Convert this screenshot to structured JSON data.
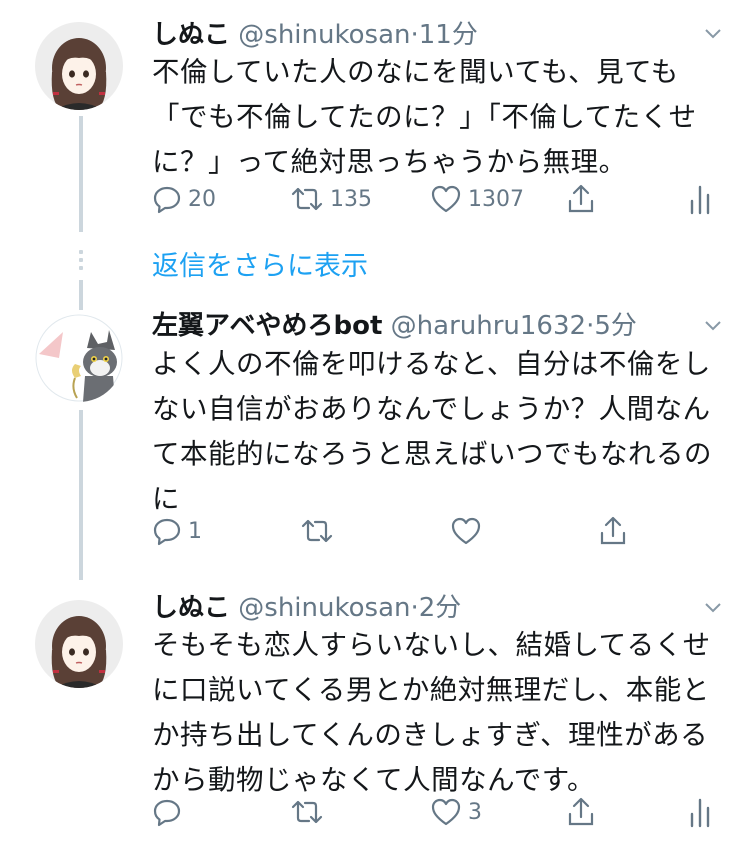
{
  "tweets": [
    {
      "name": "しぬこ",
      "handle": "@shinukosan",
      "time": "11分",
      "lines": [
        "不倫していた人のなにを聞いても、見ても",
        "「でも不倫してたのに？」「不倫してたくせ",
        "に？」って絶対思っちゃうから無理。"
      ],
      "reply_count": "20",
      "retweet_count": "135",
      "like_count": "1307"
    },
    {
      "name": "左翼アベやめろbot",
      "handle": "@haruhru1632",
      "time": "5分",
      "lines": [
        "よく人の不倫を叩けるなと、自分は不倫をし",
        "ない自信がおありなんでしょうか？人間なん",
        "て本能的になろうと思えばいつでもなれるの",
        "に"
      ],
      "reply_count": "1",
      "retweet_count": "",
      "like_count": ""
    },
    {
      "name": "しぬこ",
      "handle": "@shinukosan",
      "time": "2分",
      "lines": [
        "そもそも恋人すらいないし、結婚してるくせ",
        "に口説いてくる男とか絶対無理だし、本能と",
        "か持ち出してくんのきしょすぎ、理性がある",
        "から動物じゃなくて人間なんです。"
      ],
      "reply_count": "",
      "retweet_count": "",
      "like_count": "3"
    }
  ],
  "show_more_label": "返信をさらに表示",
  "separator": "·",
  "colors": {
    "accent": "#1da1f2",
    "meta": "#657786",
    "thread_line": "#ccd6dd"
  },
  "icons": [
    "avatar-girl-icon",
    "avatar-cat-icon",
    "reply-icon",
    "retweet-icon",
    "like-icon",
    "share-icon",
    "analytics-icon",
    "chevron-down-icon"
  ]
}
